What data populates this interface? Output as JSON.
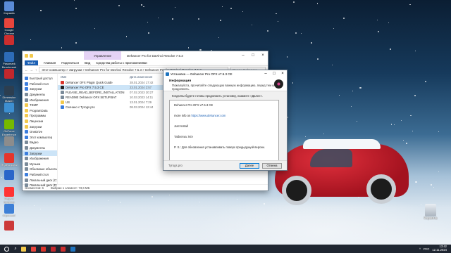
{
  "desktop": {
    "icons": [
      {
        "label": "Корзина",
        "color": "#5a8bd6"
      },
      {
        "label": "Google Chrome",
        "color": "#e8453c"
      },
      {
        "label": "",
        "color": "#cc2e2e"
      },
      {
        "label": "Passmark Benchmark",
        "color": "#2d6cb8"
      },
      {
        "label": "",
        "color": "#c1272d"
      },
      {
        "label": "Dimension Master",
        "color": "#2c3e50"
      },
      {
        "label": "",
        "color": "#3d8fd1"
      },
      {
        "label": "GeForce Experience",
        "color": "#76b900"
      },
      {
        "label": "",
        "color": "#8c8c8c"
      },
      {
        "label": "Яндекс Диск",
        "color": "#e5352b"
      },
      {
        "label": "",
        "color": "#2a66c9"
      },
      {
        "label": "Яндекс Браузер",
        "color": "#ff3333"
      },
      {
        "label": "Скриншот",
        "color": "#3d7fd6"
      },
      {
        "label": "",
        "color": "#cc3a3a"
      }
    ],
    "recycle_bin_label": "Корзина"
  },
  "explorer": {
    "manage_tab": "Управление",
    "window_title": "Dehancer Pro for DaVinci Resolve 7.5.3",
    "ribbon": [
      "Файл",
      "Главная",
      "Поделиться",
      "Вид",
      "Средства работы с приложениями"
    ],
    "path": "Этот компьютер  >  Загрузки  >  Dehancer Pro for DaVinci Resolve 7.5.3  >  Dehancer Pro for DaVinci Resolve 7.5.3",
    "search_placeholder": "Поиск: Dehancer...",
    "nav": [
      {
        "label": "Быстрый доступ",
        "color": "#3b7ddd"
      },
      {
        "label": "Рабочий стол",
        "color": "#3b7ddd"
      },
      {
        "label": "Загрузки",
        "color": "#3b7ddd"
      },
      {
        "label": "Документы",
        "color": "#7a8a99"
      },
      {
        "label": "Изображения",
        "color": "#7a8a99"
      },
      {
        "label": "TEMP",
        "color": "#f2c94c"
      },
      {
        "label": "ProgramData",
        "color": "#f2c94c"
      },
      {
        "label": "Программы",
        "color": "#f2c94c"
      },
      {
        "label": "Лицензии",
        "color": "#f2c94c"
      },
      {
        "label": "Загрузки",
        "color": "#f2c94c"
      },
      {
        "label": "OneDrive",
        "color": "#3b7ddd"
      },
      {
        "label": "Этот компьютер",
        "color": "#3b7ddd"
      },
      {
        "label": "Видео",
        "color": "#7a8a99"
      },
      {
        "label": "Документы",
        "color": "#7a8a99"
      },
      {
        "label": "Загрузки",
        "color": "#3b7ddd"
      },
      {
        "label": "Изображения",
        "color": "#7a8a99"
      },
      {
        "label": "Музыка",
        "color": "#7a8a99"
      },
      {
        "label": "Объемные объекты",
        "color": "#7a8a99"
      },
      {
        "label": "Рабочий стол",
        "color": "#3b7ddd"
      },
      {
        "label": "Локальный диск (C:)",
        "color": "#7a8a99"
      },
      {
        "label": "Локальный диск (D:)",
        "color": "#7a8a99"
      }
    ],
    "columns": [
      "Имя",
      "Дата изменения",
      "Тип"
    ],
    "files": [
      {
        "name": "Dehancer OFX Plugin Quick Guide",
        "date": "28.01.2024 17:42",
        "type": "Adobe Acrobat D...",
        "color": "#d9342b",
        "selected": false
      },
      {
        "name": "Dehancer Pro OFX 7.5.3 CE",
        "date": "23.01.2024 2:57",
        "type": "Приложение",
        "color": "#222222",
        "selected": true
      },
      {
        "name": "PLEASE_READ_BEFORE_INSTALLATION",
        "date": "07.02.2023 20:27",
        "type": "Текстовый доку...",
        "color": "#7a8a99",
        "selected": false
      },
      {
        "name": "README Dehancer OFX SETUP.BAT",
        "date": "10.03.2023 14:11",
        "type": "Пакетный файл W...",
        "color": "#7a8a99",
        "selected": false
      },
      {
        "name": "US",
        "date": "13.01.2024 7:29",
        "type": "Папка с файлами",
        "color": "#f2c94c",
        "selected": false
      },
      {
        "name": "Скачано с Tyrogs.pro",
        "date": "08.03.2024 12:44",
        "type": "Ярлык Интернета",
        "color": "#3b7ddd",
        "selected": false
      }
    ],
    "status": [
      "Элементов: 6",
      "Выбран 1 элемент: 73,6 МБ"
    ]
  },
  "installer": {
    "title": "Установка — Dehancer Pro OFX v7.5.3 CE",
    "header_title": "Информация",
    "header_subtitle": "Пожалуйста, прочитайте следующую важную информацию, перед тем как продолжить.",
    "intro": "Когда Вы будете готовы продолжить установку, нажмите «Далее».",
    "lines": [
      {
        "text": "Dehancer Pro OFX v7.5.3 CE",
        "link": ""
      },
      {
        "text": "",
        "link": ""
      },
      {
        "text": "more info on ",
        "link": "https://www.dehancer.com"
      },
      {
        "text": "",
        "link": ""
      },
      {
        "text": "Just Install",
        "link": ""
      },
      {
        "text": "",
        "link": ""
      },
      {
        "text": "Таблетка: N/A",
        "link": ""
      },
      {
        "text": "",
        "link": ""
      },
      {
        "text": "P. S.: Для обновления устанавливать поверх предыдущей версии.",
        "link": ""
      }
    ],
    "footer_label": "Tyrogs.pro",
    "next_button": "Далее",
    "cancel_button": "Отмена"
  },
  "taskbar": {
    "apps": [
      {
        "name": "explorer",
        "color": "#f2c94c"
      },
      {
        "name": "chrome",
        "color": "#e8453c"
      },
      {
        "name": "app-red",
        "color": "#d9342b"
      },
      {
        "name": "app-red-2",
        "color": "#c1272d"
      },
      {
        "name": "app-red-3",
        "color": "#cc2e2e"
      },
      {
        "name": "installer",
        "color": "#1e73be"
      }
    ],
    "tray": "^",
    "lang": "РУС",
    "time": "13:42",
    "date": "12.11.2024"
  }
}
